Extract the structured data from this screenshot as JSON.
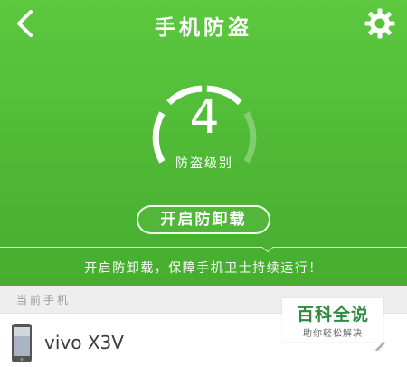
{
  "header": {
    "title": "手机防盗",
    "back_icon": "chevron-left-icon",
    "settings_icon": "gear-icon"
  },
  "protection": {
    "level_value": "4",
    "level_label": "防盗级别",
    "gauge_filled_segments": 3,
    "gauge_total_segments": 4
  },
  "actions": {
    "uninstall_protection": "开启防卸载"
  },
  "tip": {
    "text": "开启防卸载，保障手机卫士持续运行！"
  },
  "current_phone": {
    "section_title": "当前手机",
    "device_name": "vivo X3V",
    "phone_icon": "phone-icon",
    "edit_icon": "pencil-icon"
  },
  "watermark": {
    "main": "百科全说",
    "sub": "助你轻松解决"
  },
  "colors": {
    "brand_green": "#52bd39",
    "white": "#ffffff",
    "section_bg": "#eeeeee",
    "watermark_green": "#2f8b42"
  }
}
